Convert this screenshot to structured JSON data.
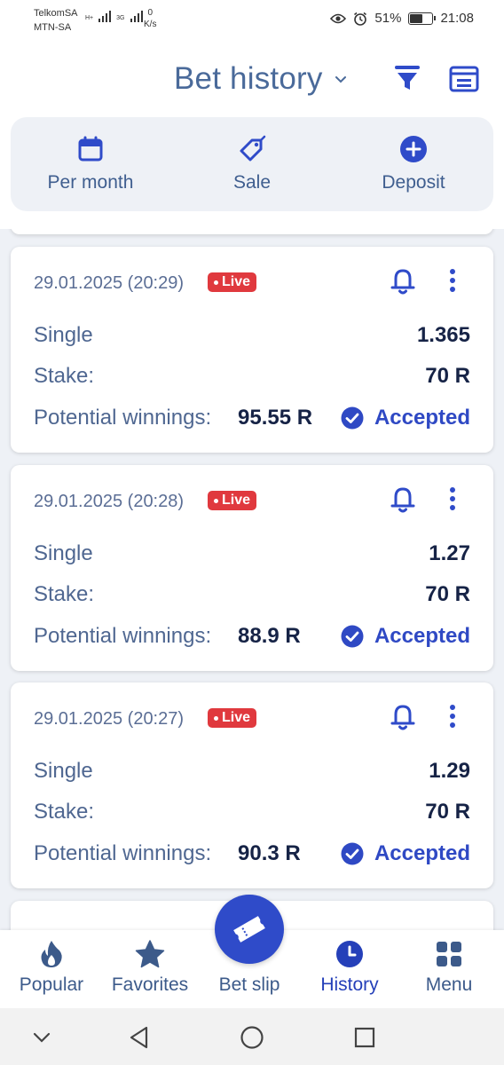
{
  "status_bar": {
    "carrier1": "TelkomSA",
    "carrier2": "MTN-SA",
    "net1": "H+",
    "net2": "3G",
    "speed_value": "0",
    "speed_unit": "K/s",
    "battery": "51%",
    "time": "21:08"
  },
  "header": {
    "title": "Bet history"
  },
  "quick_actions": [
    {
      "label": "Per month",
      "icon": "calendar-icon"
    },
    {
      "label": "Sale",
      "icon": "price-tag-icon"
    },
    {
      "label": "Deposit",
      "icon": "plus-circle-icon"
    }
  ],
  "bets": [
    {
      "date": "29.01.2025 (20:29)",
      "live": "Live",
      "type": "Single",
      "odds": "1.365",
      "stake_label": "Stake:",
      "stake": "70 R",
      "winnings_label": "Potential winnings:",
      "winnings": "95.55 R",
      "status": "Accepted"
    },
    {
      "date": "29.01.2025 (20:28)",
      "live": "Live",
      "type": "Single",
      "odds": "1.27",
      "stake_label": "Stake:",
      "stake": "70 R",
      "winnings_label": "Potential winnings:",
      "winnings": "88.9 R",
      "status": "Accepted"
    },
    {
      "date": "29.01.2025 (20:27)",
      "live": "Live",
      "type": "Single",
      "odds": "1.29",
      "stake_label": "Stake:",
      "stake": "70 R",
      "winnings_label": "Potential winnings:",
      "winnings": "90.3 R",
      "status": "Accepted"
    }
  ],
  "bottom_nav": [
    {
      "label": "Popular",
      "icon": "flame-icon"
    },
    {
      "label": "Favorites",
      "icon": "star-icon"
    },
    {
      "label": "Bet slip",
      "icon": "ticket-icon"
    },
    {
      "label": "History",
      "icon": "clock-icon",
      "active": true
    },
    {
      "label": "Menu",
      "icon": "grid-icon"
    }
  ],
  "colors": {
    "accent": "#2f4bc9",
    "title": "#4a6a9a",
    "live": "#e0393e",
    "background": "#eef1f6"
  }
}
